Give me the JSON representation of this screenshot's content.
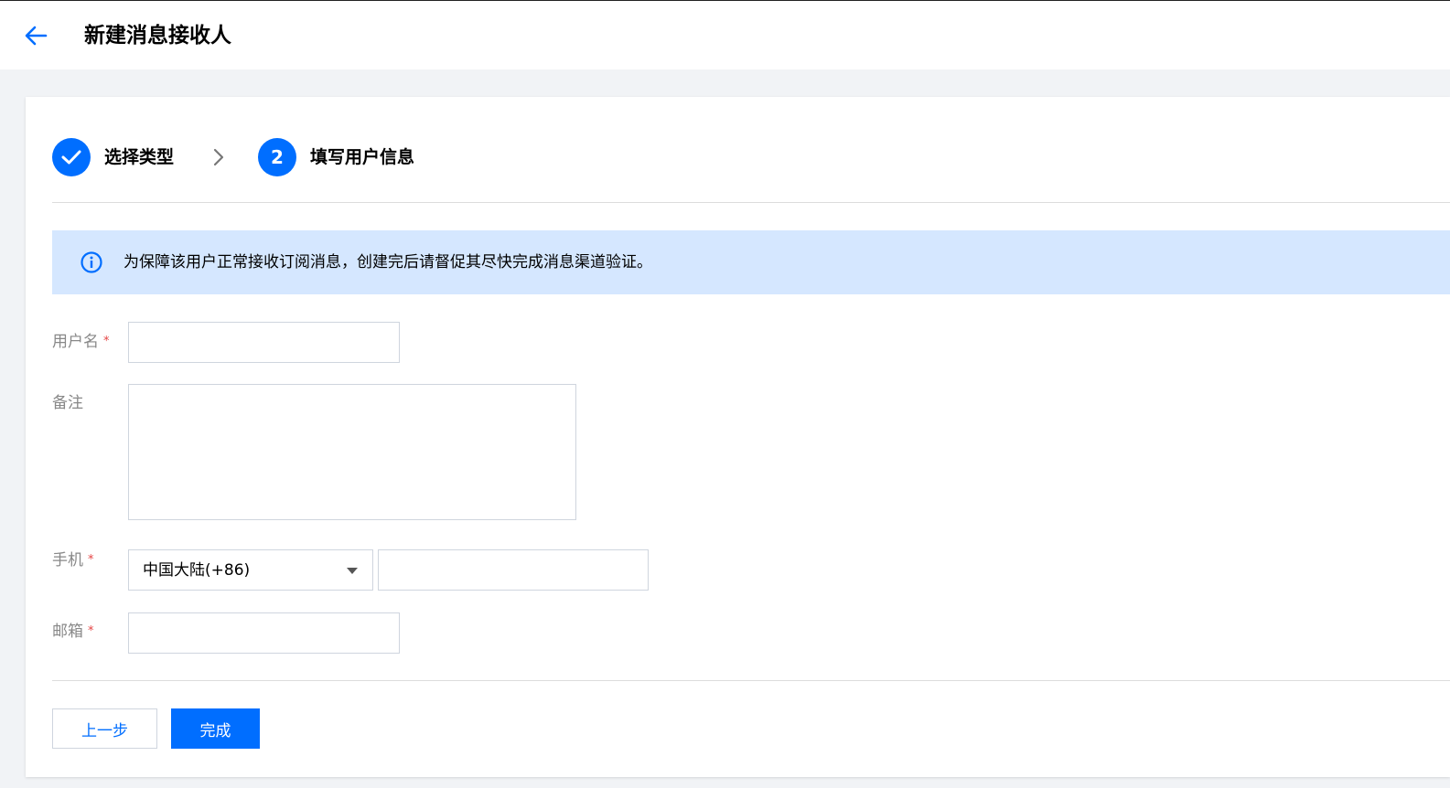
{
  "header": {
    "title": "新建消息接收人",
    "back_icon": "arrow-left-icon"
  },
  "colors": {
    "accent": "#006eff",
    "notice_bg": "#d5e7ff",
    "required": "#e54545"
  },
  "steps": [
    {
      "label": "选择类型",
      "status": "completed",
      "icon": "check-icon"
    },
    {
      "number": "2",
      "label": "填写用户信息",
      "status": "current"
    }
  ],
  "notice": {
    "icon": "info-icon",
    "text": "为保障该用户正常接收订阅消息，创建完后请督促其尽快完成消息渠道验证。"
  },
  "form": {
    "required_mark": "*",
    "username": {
      "label": "用户名",
      "value": "",
      "required": true
    },
    "remark": {
      "label": "备注",
      "value": "",
      "required": false
    },
    "phone": {
      "label": "手机",
      "required": true,
      "region": "中国大陆(+86)",
      "value": ""
    },
    "email": {
      "label": "邮箱",
      "value": "",
      "required": true
    }
  },
  "buttons": {
    "prev": "上一步",
    "done": "完成"
  }
}
